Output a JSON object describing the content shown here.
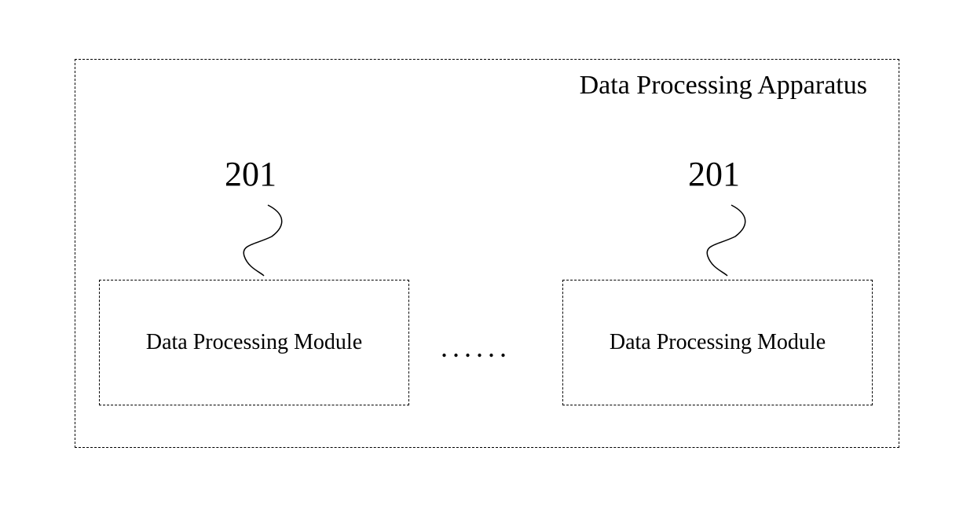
{
  "apparatus": {
    "title": "Data Processing Apparatus"
  },
  "modules": {
    "left": {
      "ref": "201",
      "label": "Data Processing Module"
    },
    "right": {
      "ref": "201",
      "label": "Data Processing Module"
    },
    "ellipsis": "......"
  }
}
